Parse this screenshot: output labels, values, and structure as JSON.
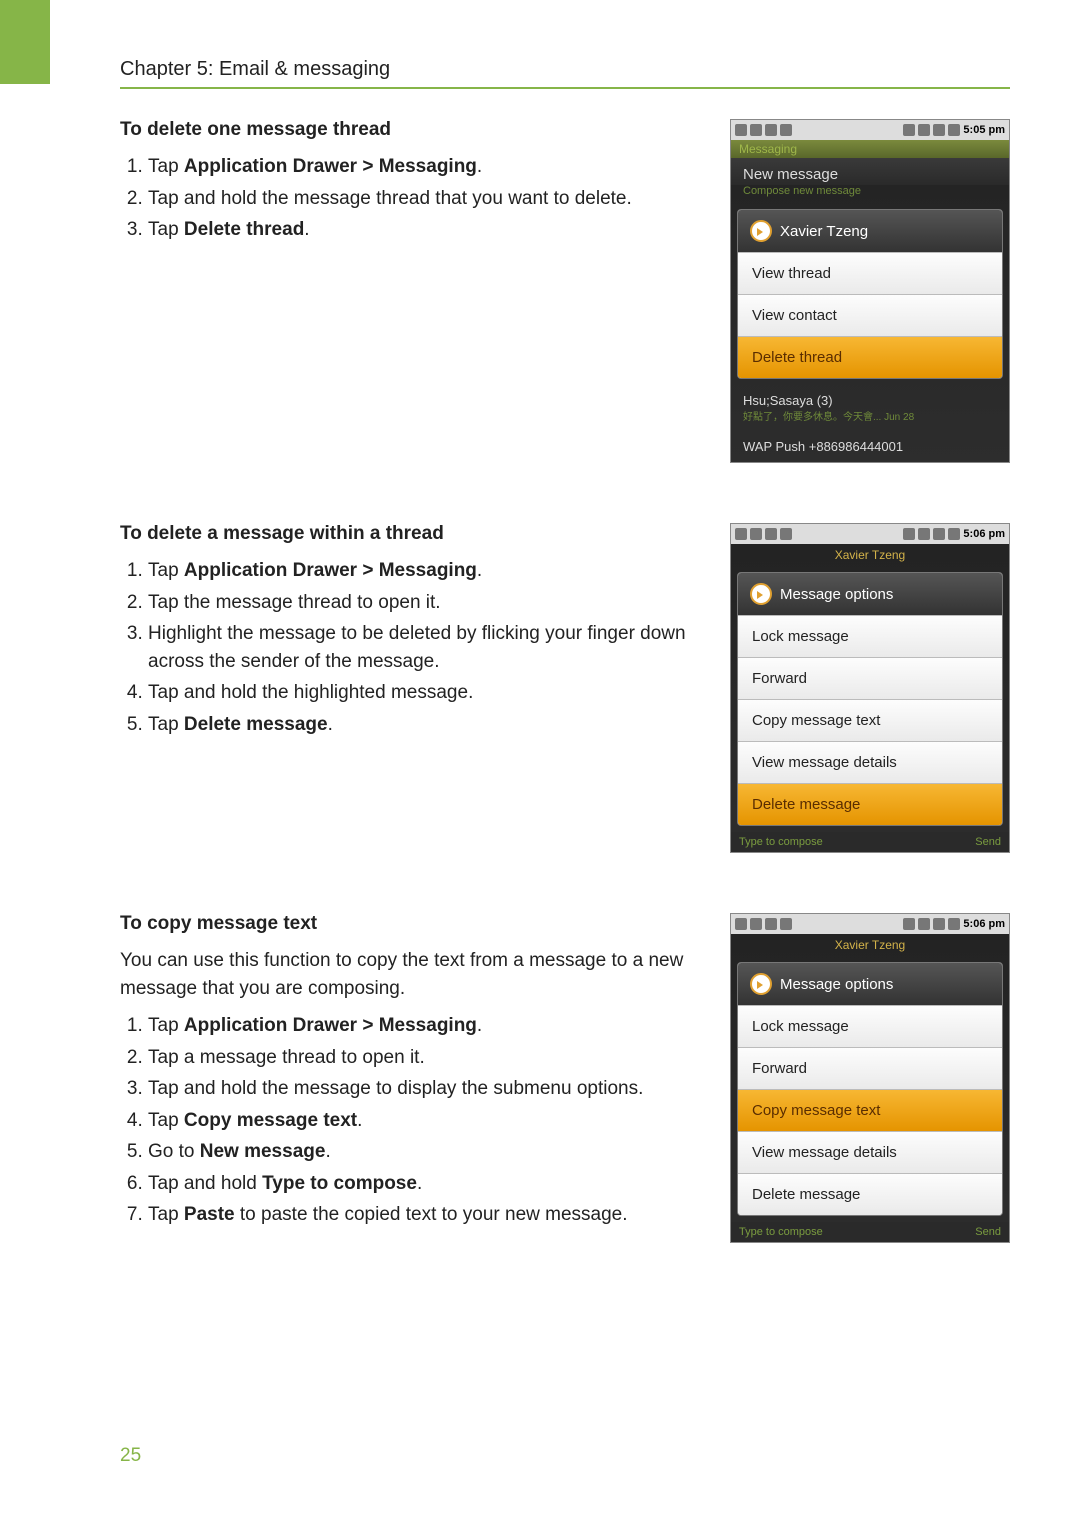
{
  "chapter": "Chapter 5: Email & messaging",
  "page_number": "25",
  "sections": [
    {
      "heading": "To delete one message thread",
      "steps": [
        {
          "pre": "Tap ",
          "bold": "Application Drawer > Messaging",
          "post": "."
        },
        {
          "pre": "Tap and hold the message thread that you want to delete.",
          "bold": "",
          "post": ""
        },
        {
          "pre": "Tap ",
          "bold": "Delete thread",
          "post": "."
        }
      ],
      "screenshot": {
        "time": "5:05 pm",
        "title": "Messaging",
        "subtitle": "New message",
        "subtitle_hint": "Compose new message",
        "menu_header": "Xavier Tzeng",
        "menu_items": [
          {
            "label": "View thread",
            "highlight": false
          },
          {
            "label": "View contact",
            "highlight": false
          },
          {
            "label": "Delete thread",
            "highlight": true
          }
        ],
        "bg_rows": [
          {
            "title": "Hsu;Sasaya (3)",
            "sub": "好點了，你要多休息。今天會...  Jun 28"
          },
          {
            "title": "WAP Push +886986444001",
            "sub": ""
          }
        ]
      }
    },
    {
      "heading": "To delete a message within a thread",
      "steps": [
        {
          "pre": "Tap ",
          "bold": "Application Drawer > Messaging",
          "post": "."
        },
        {
          "pre": "Tap the message thread to open it.",
          "bold": "",
          "post": ""
        },
        {
          "pre": "Highlight the message to be deleted by flicking your finger down across the sender of the message.",
          "bold": "",
          "post": ""
        },
        {
          "pre": "Tap and hold the highlighted message.",
          "bold": "",
          "post": ""
        },
        {
          "pre": "Tap ",
          "bold": "Delete message",
          "post": "."
        }
      ],
      "screenshot": {
        "time": "5:06 pm",
        "back_title": "Xavier Tzeng",
        "menu_header": "Message options",
        "menu_items": [
          {
            "label": "Lock message",
            "highlight": false
          },
          {
            "label": "Forward",
            "highlight": false
          },
          {
            "label": "Copy message text",
            "highlight": false
          },
          {
            "label": "View message details",
            "highlight": false
          },
          {
            "label": "Delete message",
            "highlight": true
          }
        ],
        "compose_placeholder": "Type to compose",
        "compose_send": "Send"
      }
    },
    {
      "heading": "To copy message text",
      "intro": "You can use this function to copy the text from a message to a new message that you are composing.",
      "steps": [
        {
          "pre": "Tap ",
          "bold": "Application Drawer > Messaging",
          "post": "."
        },
        {
          "pre": "Tap a message thread to open it.",
          "bold": "",
          "post": ""
        },
        {
          "pre": "Tap and hold the message to display the submenu options.",
          "bold": "",
          "post": ""
        },
        {
          "pre": "Tap ",
          "bold": "Copy message text",
          "post": "."
        },
        {
          "pre": "Go to ",
          "bold": "New message",
          "post": "."
        },
        {
          "pre": "Tap and hold ",
          "bold": "Type to compose",
          "post": "."
        },
        {
          "pre": "Tap ",
          "bold": "Paste",
          "post": " to paste the copied text to your new message."
        }
      ],
      "screenshot": {
        "time": "5:06 pm",
        "back_title": "Xavier Tzeng",
        "menu_header": "Message options",
        "menu_items": [
          {
            "label": "Lock message",
            "highlight": false
          },
          {
            "label": "Forward",
            "highlight": false
          },
          {
            "label": "Copy message text",
            "highlight": true
          },
          {
            "label": "View message details",
            "highlight": false
          },
          {
            "label": "Delete message",
            "highlight": false
          }
        ],
        "compose_placeholder": "Type to compose",
        "compose_send": "Send"
      }
    }
  ]
}
